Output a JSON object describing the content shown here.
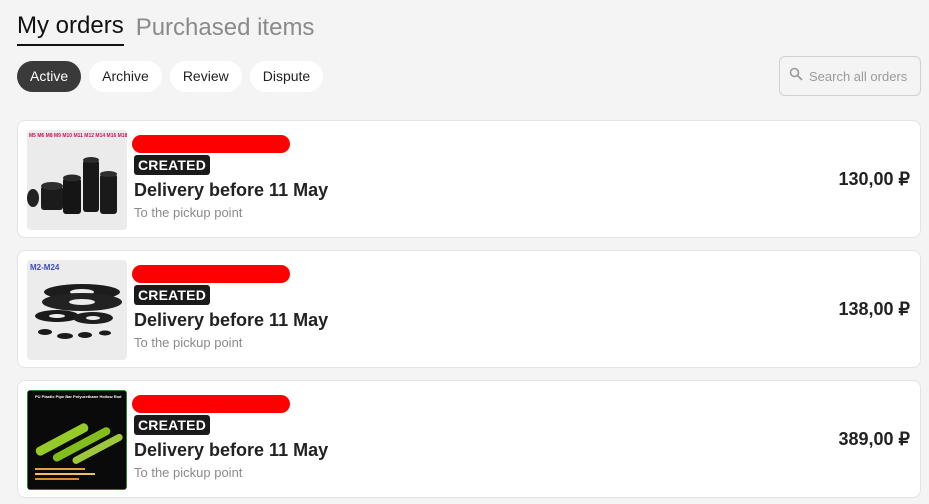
{
  "tabs": [
    {
      "label": "My orders",
      "active": true
    },
    {
      "label": "Purchased items",
      "active": false
    }
  ],
  "filters": [
    {
      "label": "Active",
      "selected": true
    },
    {
      "label": "Archive",
      "selected": false
    },
    {
      "label": "Review",
      "selected": false
    },
    {
      "label": "Dispute",
      "selected": false
    }
  ],
  "search": {
    "placeholder": "Search all orders",
    "icon": "search-icon"
  },
  "orders": [
    {
      "status": "CREATED",
      "delivery": "Delivery before 11 May",
      "pickup": "To the pickup point",
      "price": "130,00 ₽",
      "thumb_label": "M5 M6 M8 M9 M10 M11 M12 M14 M16 M18"
    },
    {
      "status": "CREATED",
      "delivery": "Delivery before 11 May",
      "pickup": "To the pickup point",
      "price": "138,00 ₽",
      "thumb_label": "M2-M24"
    },
    {
      "status": "CREATED",
      "delivery": "Delivery before 11 May",
      "pickup": "To the pickup point",
      "price": "389,00 ₽",
      "thumb_label": "PU Plastic Pipe Bar Polyurethane Hollow Rod"
    }
  ],
  "colors": {
    "redaction": "#ff0000",
    "badge_bg": "#1a1a1a",
    "selected_chip": "#3a3a3a"
  }
}
